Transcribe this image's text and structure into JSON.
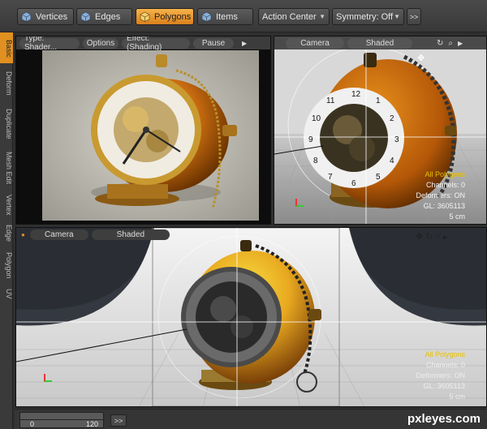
{
  "toolbar": {
    "vertices": "Vertices",
    "edges": "Edges",
    "polygons": "Polygons",
    "items": "Items",
    "action_center": "Action Center",
    "symmetry": "Symmetry: Off",
    "more": ">>"
  },
  "sidetabs": [
    "Basic",
    "Deform",
    "Duplicate",
    "Mesh Edit",
    "Vertex",
    "Edge",
    "Polygon",
    "UV"
  ],
  "preview": {
    "type": "Type: Shader...",
    "options": "Options",
    "effect": "Effect: (Shading)",
    "pause": "Pause"
  },
  "viewport_top": {
    "camera": "Camera",
    "shading": "Shaded",
    "info": [
      "All Polygons",
      "Channels: 0",
      "Deformers: ON",
      "GL: 3605113",
      "5 cm"
    ]
  },
  "viewport_main": {
    "camera": "Camera",
    "shading": "Shaded",
    "info": [
      "All Polygons",
      "Channels: 0",
      "Deformers: ON",
      "GL: 3605113",
      "5 cm"
    ]
  },
  "timeline": {
    "start": "0",
    "end": "120",
    "more": ">>"
  },
  "watermark": "pxleyes.com",
  "clock_numbers": [
    "12",
    "1",
    "2",
    "3",
    "4",
    "5",
    "6",
    "7",
    "8",
    "9",
    "10",
    "11"
  ],
  "colors": {
    "accent": "#e09020",
    "info_yellow": "#e8c000"
  }
}
